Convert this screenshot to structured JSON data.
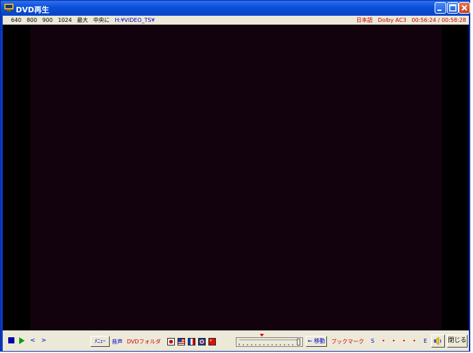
{
  "window": {
    "title": "DVD再生"
  },
  "info": {
    "sizes": [
      "640",
      "800",
      "900",
      "1024"
    ],
    "max": "最大",
    "center": "中央に",
    "path": "H:¥VIDEO_TS¥",
    "language": "日本語",
    "audio": "Dolby AC3",
    "time": "00:56:24 / 00:58:28"
  },
  "controls": {
    "prev": "<",
    "next": ">",
    "menu": "ﾒﾆｭｰ",
    "audio": "音声",
    "dvd_folder": "DVDフォルダ",
    "move": "← 移動",
    "bookmark": "ブックマーク",
    "bm_start": "S",
    "bm_end": "E",
    "close": "閉じる"
  },
  "colors": {
    "accent_red": "#cc0000",
    "accent_blue": "#0000cc",
    "video_bg": "#12020e"
  }
}
